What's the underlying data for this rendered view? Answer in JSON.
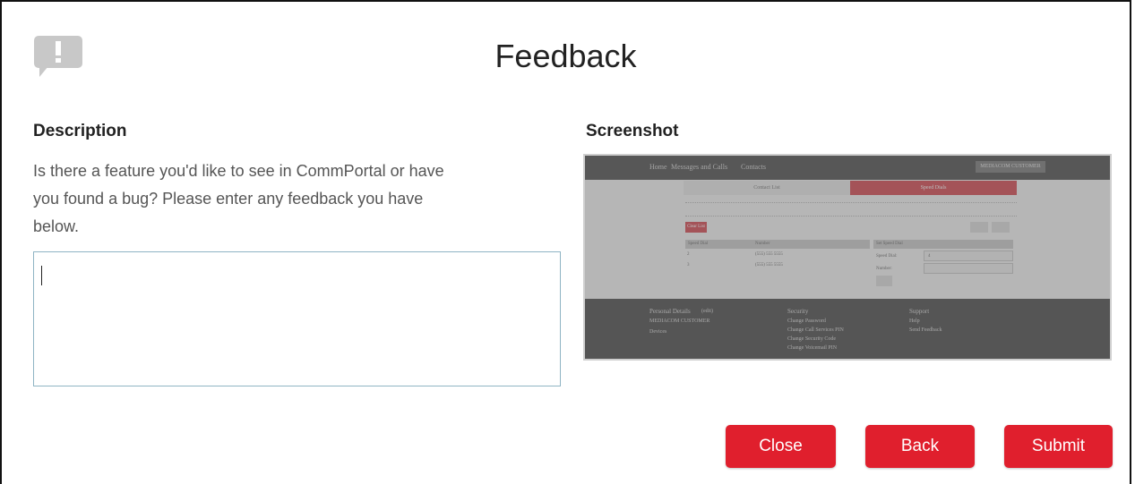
{
  "dialog": {
    "title": "Feedback",
    "icon": "feedback-speech-bubble-icon"
  },
  "description": {
    "heading": "Description",
    "text_line1": "Is there a feature you'd like to see in CommPortal or have",
    "text_line2": "you found a bug? Please enter any feedback you have",
    "text_line3": "below.",
    "input_value": ""
  },
  "screenshot": {
    "heading": "Screenshot",
    "preview": {
      "nav": [
        "Home",
        "Messages  and Calls",
        "Contacts"
      ],
      "user_menu": "MEDIACOM CUSTOMER",
      "tabs": [
        "Contact List",
        "Speed Dials"
      ],
      "clear_button": "Clear List",
      "table_headers": [
        "Speed Dial",
        "Number",
        "Set Speed Dial"
      ],
      "rows": [
        {
          "dial": "2",
          "number": "(555) 555 5555"
        },
        {
          "dial": "3",
          "number": "(555) 555 5555"
        }
      ],
      "form_labels": [
        "Speed Dial:",
        "Number:"
      ],
      "form_value": "4",
      "footer": {
        "col1_title": "Personal Details",
        "col1_edit": "(edit)",
        "col1_items": [
          "MEDIACOM CUSTOMER",
          "Devices"
        ],
        "col2_title": "Security",
        "col2_items": [
          "Change Password",
          "Change Call Services PIN",
          "Change Security Code",
          "Change Voicemail PIN"
        ],
        "col3_title": "Support",
        "col3_items": [
          "Help",
          "Send Feedback"
        ]
      }
    }
  },
  "buttons": {
    "close": "Close",
    "back": "Back",
    "submit": "Submit"
  },
  "colors": {
    "primary_button": "#e01f2d",
    "icon_gray": "#c8c8c8",
    "input_border": "#8fb4c4"
  }
}
